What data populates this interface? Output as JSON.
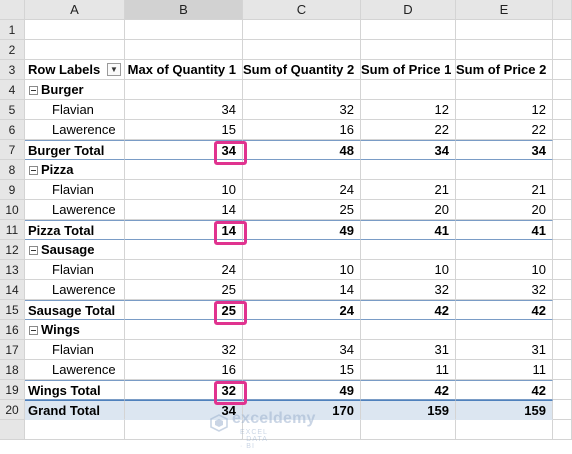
{
  "columns": [
    "A",
    "B",
    "C",
    "D",
    "E"
  ],
  "pivot": {
    "header": {
      "row_labels": "Row Labels",
      "measures": [
        "Max of Quantity 1",
        "Sum of Quantity 2",
        "Sum of Price 1",
        "Sum of Price 2"
      ]
    },
    "groups": [
      {
        "label": "Burger",
        "items": [
          {
            "name": "Flavian",
            "values": [
              "34",
              "32",
              "12",
              "12"
            ]
          },
          {
            "name": "Lawerence",
            "values": [
              "15",
              "16",
              "22",
              "22"
            ]
          }
        ],
        "total_label": "Burger Total",
        "total": [
          "34",
          "48",
          "34",
          "34"
        ]
      },
      {
        "label": "Pizza",
        "items": [
          {
            "name": "Flavian",
            "values": [
              "10",
              "24",
              "21",
              "21"
            ]
          },
          {
            "name": "Lawerence",
            "values": [
              "14",
              "25",
              "20",
              "20"
            ]
          }
        ],
        "total_label": "Pizza Total",
        "total": [
          "14",
          "49",
          "41",
          "41"
        ]
      },
      {
        "label": "Sausage",
        "items": [
          {
            "name": "Flavian",
            "values": [
              "24",
              "10",
              "10",
              "10"
            ]
          },
          {
            "name": "Lawerence",
            "values": [
              "25",
              "14",
              "32",
              "32"
            ]
          }
        ],
        "total_label": "Sausage Total",
        "total": [
          "25",
          "24",
          "42",
          "42"
        ]
      },
      {
        "label": "Wings",
        "items": [
          {
            "name": "Flavian",
            "values": [
              "32",
              "34",
              "31",
              "31"
            ]
          },
          {
            "name": "Lawerence",
            "values": [
              "16",
              "15",
              "11",
              "11"
            ]
          }
        ],
        "total_label": "Wings Total",
        "total": [
          "32",
          "49",
          "42",
          "42"
        ]
      }
    ],
    "grand_total_label": "Grand Total",
    "grand_total": [
      "34",
      "170",
      "159",
      "159"
    ]
  },
  "watermark": {
    "name": "exceldemy",
    "tagline": "EXCEL · DATA · BI"
  },
  "colors": {
    "highlight": "#e0338f",
    "grand_total_fill": "#dce6f1",
    "header_gray": "#e6e6e6"
  }
}
